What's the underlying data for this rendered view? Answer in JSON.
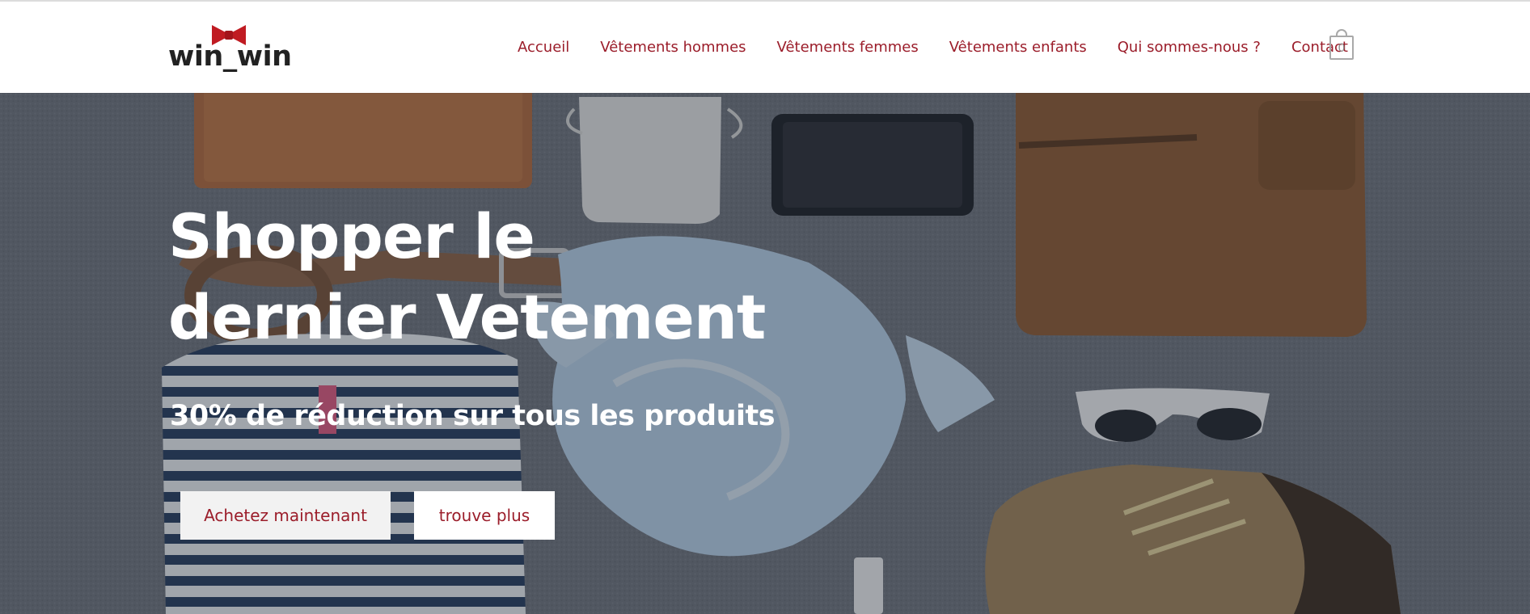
{
  "header": {
    "logo_text": "win_win",
    "nav": [
      {
        "label": "Accueil"
      },
      {
        "label": "Vêtements hommes"
      },
      {
        "label": "Vêtements femmes"
      },
      {
        "label": "Vêtements enfants"
      },
      {
        "label": "Qui sommes-nous ?"
      },
      {
        "label": "Contact"
      }
    ],
    "cart": {
      "count": "0",
      "icon": "shopping-bag-icon"
    }
  },
  "hero": {
    "title": "Shopper le dernier Vetement",
    "subtitle": "30% de réduction sur tous les produits",
    "primary_button": "Achetez maintenant",
    "secondary_button": "trouve plus"
  },
  "colors": {
    "accent": "#9b1d2a",
    "logo_bow": "#c01b22",
    "header_bg": "#ffffff",
    "hero_overlay": "#232a37"
  }
}
